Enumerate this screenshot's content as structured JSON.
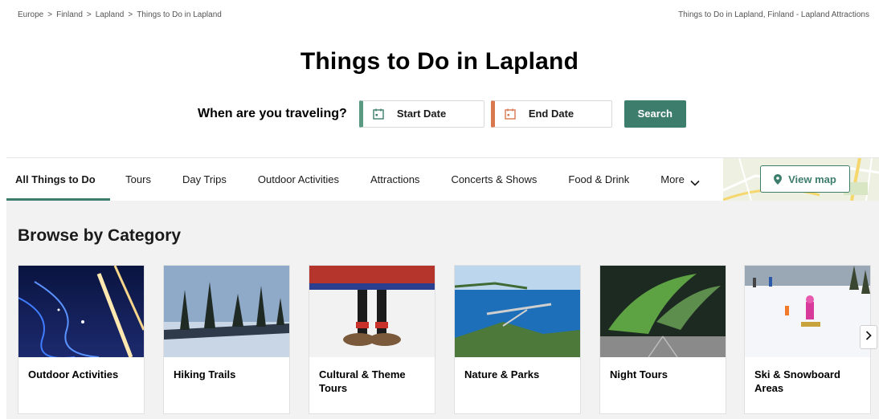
{
  "breadcrumb": {
    "items": [
      "Europe",
      "Finland",
      "Lapland",
      "Things to Do in Lapland"
    ],
    "separator": ">"
  },
  "header_right_text": "Things to Do in Lapland, Finland - Lapland Attractions",
  "page_title": "Things to Do in Lapland",
  "date_picker": {
    "question": "When are you traveling?",
    "start_label": "Start Date",
    "end_label": "End Date",
    "search_label": "Search"
  },
  "nav": {
    "tabs": [
      {
        "label": "All Things to Do",
        "active": true
      },
      {
        "label": "Tours"
      },
      {
        "label": "Day Trips"
      },
      {
        "label": "Outdoor Activities"
      },
      {
        "label": "Attractions"
      },
      {
        "label": "Concerts & Shows"
      },
      {
        "label": "Food & Drink"
      },
      {
        "label": "More"
      }
    ],
    "view_map_label": "View map"
  },
  "browse": {
    "title": "Browse by Category",
    "categories": [
      {
        "label": "Outdoor Activities"
      },
      {
        "label": "Hiking Trails"
      },
      {
        "label": "Cultural & Theme Tours"
      },
      {
        "label": "Nature & Parks"
      },
      {
        "label": "Night Tours"
      },
      {
        "label": "Ski & Snowboard Areas"
      }
    ]
  },
  "colors": {
    "accent_green": "#3d7d6b",
    "start_date_bar": "#5a9a83",
    "end_date_bar": "#d9774f",
    "browse_bg": "#f2f2f2"
  },
  "icons": [
    "chevron-right-icon",
    "calendar-icon",
    "chevron-down-icon",
    "map-pin-icon"
  ]
}
